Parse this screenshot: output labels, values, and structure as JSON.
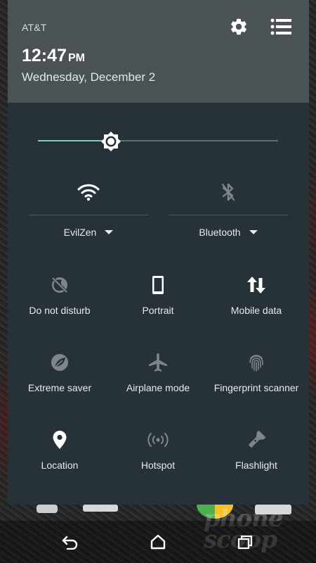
{
  "status": {
    "carrier": "AT&T"
  },
  "header": {
    "time": "12:47",
    "ampm": "PM",
    "date": "Wednesday, December 2"
  },
  "brightness": {
    "level": 0.305
  },
  "big_tiles": [
    {
      "id": "wifi",
      "label": "EvilZen",
      "icon": "wifi-icon",
      "active": true
    },
    {
      "id": "bluetooth",
      "label": "Bluetooth",
      "icon": "bluetooth-icon",
      "active": false
    }
  ],
  "tiles": [
    {
      "label": "Do not disturb",
      "icon": "do-not-disturb-icon",
      "active": false
    },
    {
      "label": "Portrait",
      "icon": "portrait-icon",
      "active": true
    },
    {
      "label": "Mobile data",
      "icon": "mobile-data-icon",
      "active": true
    },
    {
      "label": "Extreme saver",
      "icon": "extreme-saver-icon",
      "active": false
    },
    {
      "label": "Airplane mode",
      "icon": "airplane-icon",
      "active": false
    },
    {
      "label": "Fingerprint scanner",
      "icon": "fingerprint-icon",
      "active": false
    },
    {
      "label": "Location",
      "icon": "location-icon",
      "active": true
    },
    {
      "label": "Hotspot",
      "icon": "hotspot-icon",
      "active": false
    },
    {
      "label": "Flashlight",
      "icon": "flashlight-icon",
      "active": false
    }
  ],
  "watermark": "phone scoop",
  "colors": {
    "header_bg": "#4a5255",
    "panel_bg": "#263238",
    "accent": "#80cbc4",
    "icon_active": "#ffffff",
    "icon_inactive": "#7d878b"
  }
}
